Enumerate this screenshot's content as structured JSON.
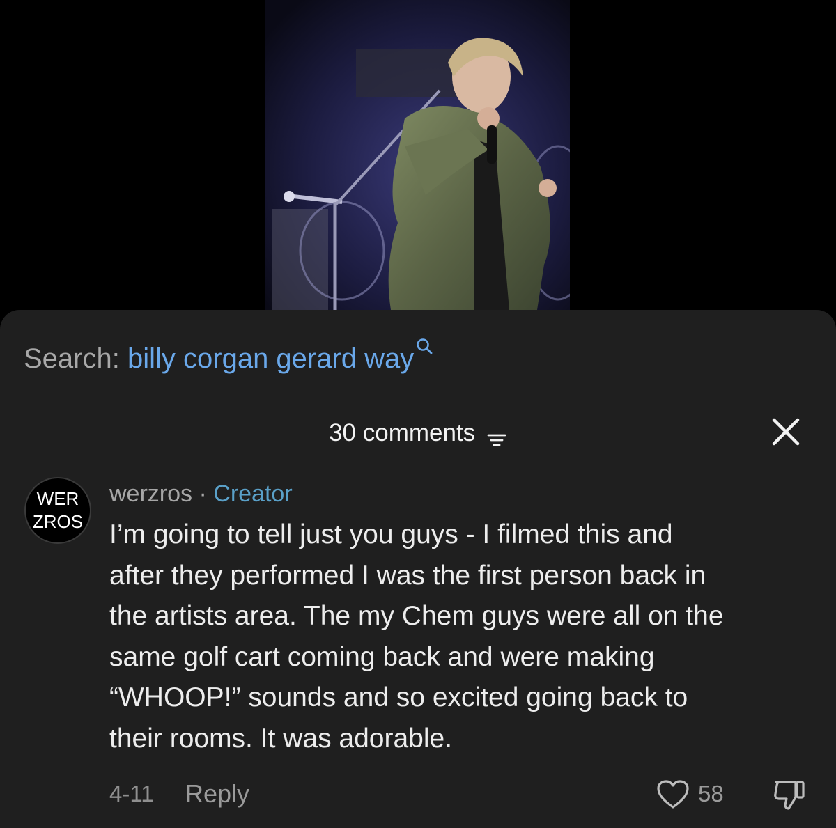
{
  "search": {
    "prefix": "Search:",
    "query": "billy corgan gerard way"
  },
  "comments_header": {
    "count_label": "30 comments"
  },
  "comment": {
    "avatar_text_line1": "WER",
    "avatar_text_line2": "ZROS",
    "username": "werzros",
    "separator": "·",
    "badge": "Creator",
    "text_lines": [
      "I’m going to tell just you guys - I filmed this and",
      "after they performed I was the first person back in",
      "the artists area. The my Chem guys were all on the",
      "same golf cart coming back and were making",
      "“WHOOP!” sounds and so excited going back to",
      "their rooms. It was adorable."
    ],
    "date": "4-11",
    "reply_label": "Reply",
    "like_count": "58"
  },
  "icons": {
    "search": "search-icon",
    "sort": "sort-icon",
    "close": "close-icon",
    "like": "heart-icon",
    "dislike": "thumbs-down-icon"
  },
  "colors": {
    "background": "#000000",
    "sheet": "#1f1f1f",
    "search_query": "#6aa8ea",
    "creator_badge": "#5aa0c8"
  }
}
